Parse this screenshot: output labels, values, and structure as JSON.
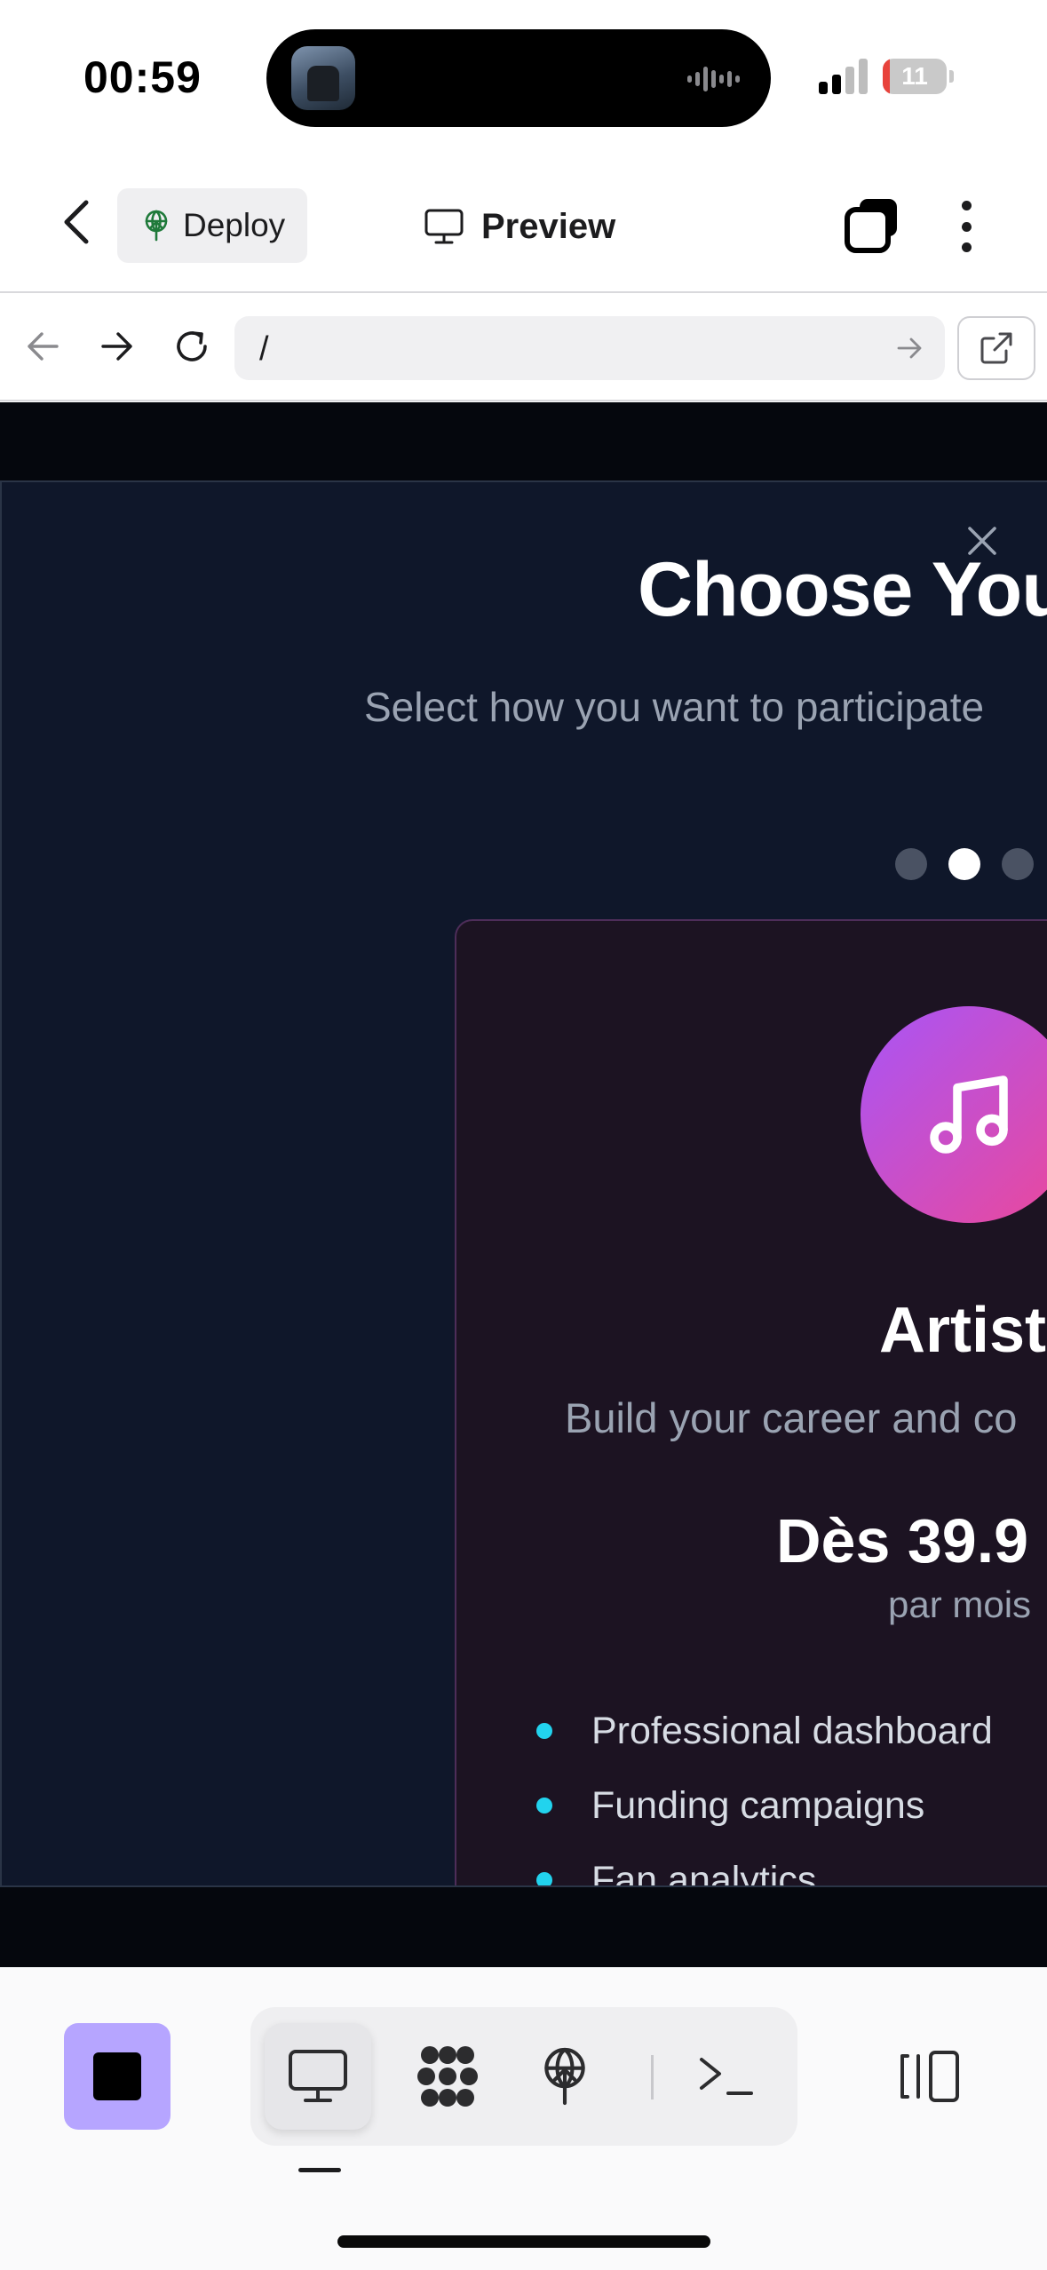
{
  "status_bar": {
    "time": "00:59",
    "battery_level": "11",
    "battery_fill_fraction": 0.11,
    "battery_color": "#e8423b"
  },
  "header": {
    "back_icon": "chevron-left-icon",
    "deploy_label": "Deploy",
    "deploy_icon": "antenna-icon",
    "preview_label": "Preview",
    "preview_icon": "monitor-icon",
    "stack_icon": "stacked-squares-icon",
    "more_icon": "more-vertical-icon"
  },
  "browser": {
    "url": "/",
    "back_icon": "arrow-left-icon",
    "forward_icon": "arrow-right-icon",
    "reload_icon": "refresh-icon",
    "go_icon": "arrow-right-icon",
    "open_external_icon": "external-link-icon"
  },
  "modal": {
    "title": "Choose You",
    "subtitle": "Select how you want to participate",
    "close_icon": "close-icon",
    "carousel": {
      "total": 3,
      "active_index": 1
    },
    "card": {
      "icon": "music-note-icon",
      "name": "Artist",
      "description": "Build your career and co",
      "price": "Dès 39.9",
      "period": "par mois",
      "features": [
        "Professional dashboard",
        "Funding campaigns",
        "Fan analytics"
      ],
      "accent_gradient": [
        "#a855f7",
        "#ec4899"
      ],
      "bullet_color": "#22d3ee"
    }
  },
  "toolbar": {
    "stop_color": "#b6a5ff",
    "tools": [
      {
        "name": "preview",
        "icon": "monitor-icon",
        "active": true
      },
      {
        "name": "blocks",
        "icon": "blocks-icon",
        "active": false
      },
      {
        "name": "deploy",
        "icon": "antenna-icon",
        "active": false
      },
      {
        "name": "console",
        "icon": "terminal-icon",
        "active": false
      }
    ],
    "split_icon": "split-view-icon"
  }
}
